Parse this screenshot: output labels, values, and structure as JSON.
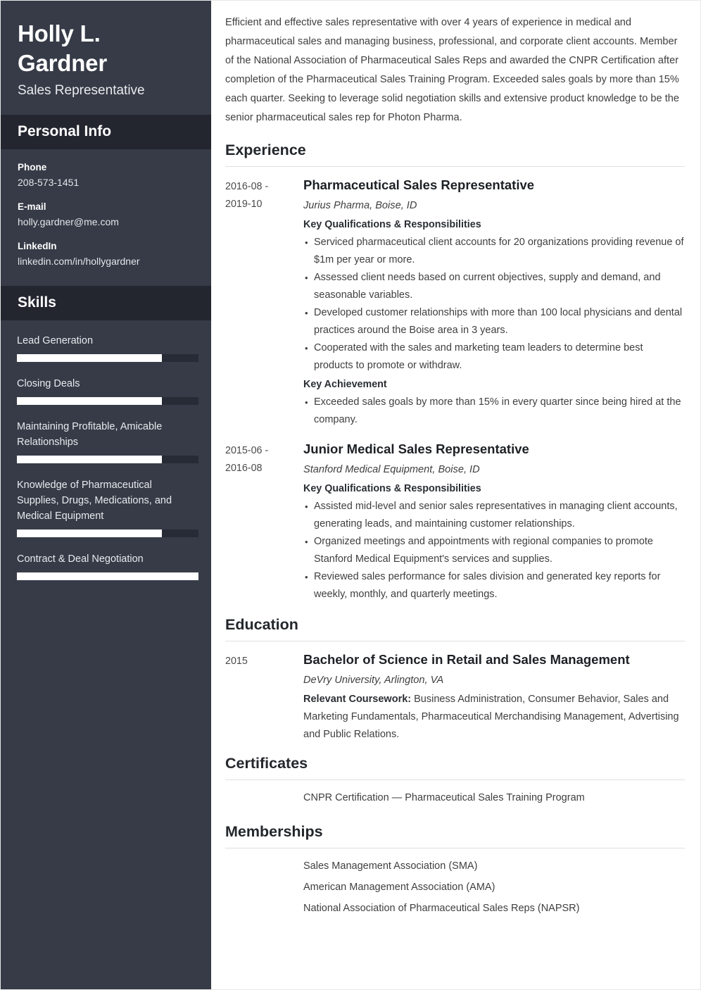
{
  "theme": {
    "sidebar_bg": "#363b47",
    "sidebar_head_bg": "#23262f",
    "bar_track": "#272b36",
    "bar_fill": "#ffffff",
    "text_dark": "#3f3f3f",
    "heading_dark": "#23262b",
    "rule": "#e0e0e0"
  },
  "sidebar": {
    "name": "Holly L. Gardner",
    "title": "Sales Representative",
    "personal_info": {
      "heading": "Personal Info",
      "items": [
        {
          "label": "Phone",
          "value": "208-573-1451"
        },
        {
          "label": "E-mail",
          "value": "holly.gardner@me.com"
        },
        {
          "label": "LinkedIn",
          "value": "linkedin.com/in/hollygardner"
        }
      ]
    },
    "skills": {
      "heading": "Skills",
      "items": [
        {
          "name": "Lead Generation",
          "level": 80
        },
        {
          "name": "Closing Deals",
          "level": 80
        },
        {
          "name": "Maintaining Profitable, Amicable Relationships",
          "level": 80
        },
        {
          "name": "Knowledge of Pharmaceutical Supplies, Drugs, Medications, and Medical Equipment",
          "level": 80
        },
        {
          "name": "Contract & Deal Negotiation",
          "level": 100
        }
      ]
    }
  },
  "main": {
    "summary": "Efficient and effective sales representative with over 4 years of experience in medical and pharmaceutical sales and managing business, professional, and corporate client accounts. Member of the National Association of Pharmaceutical Sales Reps and awarded the CNPR Certification after completion of the Pharmaceutical Sales Training Program. Exceeded sales goals by more than 15% each quarter. Seeking to leverage solid negotiation skills and extensive product knowledge to be the senior pharmaceutical sales rep for Photon Pharma.",
    "experience": {
      "heading": "Experience",
      "entries": [
        {
          "date_line1": "2016-08 -",
          "date_line2": "2019-10",
          "role": "Pharmaceutical Sales Representative",
          "org": "Jurius Pharma, Boise, ID",
          "qualifications_label": "Key Qualifications & Responsibilities",
          "bullets": [
            "Serviced pharmaceutical client accounts for 20 organizations providing revenue of $1m per year or more.",
            "Assessed client needs based on current objectives, supply and demand, and seasonable variables.",
            "Developed customer relationships with more than 100 local physicians and dental practices around the Boise area in 3 years.",
            "Cooperated with the sales and marketing team leaders to determine best products to promote or withdraw."
          ],
          "achievement_label": "Key Achievement",
          "achievements": [
            "Exceeded sales goals by more than 15% in every quarter since being hired at the company."
          ]
        },
        {
          "date_line1": "2015-06 -",
          "date_line2": "2016-08",
          "role": "Junior Medical Sales Representative",
          "org": "Stanford Medical Equipment, Boise, ID",
          "qualifications_label": "Key Qualifications & Responsibilities",
          "bullets": [
            "Assisted mid-level and senior sales representatives in managing client accounts, generating leads, and maintaining customer relationships.",
            "Organized meetings and appointments with regional companies to promote Stanford Medical Equipment's services and supplies.",
            "Reviewed sales performance for sales division and generated key reports for weekly, monthly, and quarterly meetings."
          ],
          "achievement_label": "",
          "achievements": []
        }
      ]
    },
    "education": {
      "heading": "Education",
      "date": "2015",
      "degree": "Bachelor of Science in Retail and Sales Management",
      "school": "DeVry University, Arlington, VA",
      "coursework_label": "Relevant Coursework:",
      "coursework": " Business Administration, Consumer Behavior, Sales and Marketing Fundamentals, Pharmaceutical Merchandising Management, Advertising and Public Relations."
    },
    "certificates": {
      "heading": "Certificates",
      "items": [
        "CNPR Certification — Pharmaceutical Sales Training Program"
      ]
    },
    "memberships": {
      "heading": "Memberships",
      "items": [
        "Sales Management Association (SMA)",
        "American Management Association (AMA)",
        "National Association of Pharmaceutical Sales Reps (NAPSR)"
      ]
    }
  }
}
